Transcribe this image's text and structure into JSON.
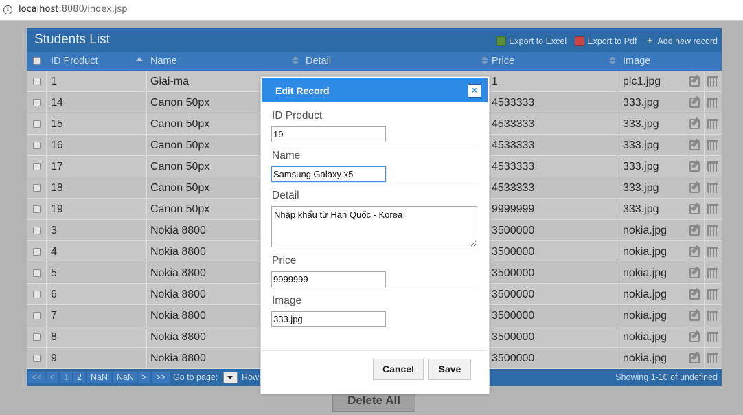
{
  "browser": {
    "url_host": "localhost",
    "url_rest": ":8080/index.jsp"
  },
  "grid": {
    "title": "Students List",
    "toolbar": {
      "excel": "Export to Excel",
      "pdf": "Export to Pdf",
      "add": "Add new record"
    },
    "columns": {
      "id": "ID Product",
      "name": "Name",
      "detail": "Detail",
      "price": "Price",
      "image": "Image"
    },
    "rows": [
      {
        "id": "1",
        "name": "Giai-ma",
        "price": "1",
        "image": "pic1.jpg"
      },
      {
        "id": "14",
        "name": "Canon 50px",
        "price": "4533333",
        "image": "333.jpg"
      },
      {
        "id": "15",
        "name": "Canon 50px",
        "price": "4533333",
        "image": "333.jpg"
      },
      {
        "id": "16",
        "name": "Canon 50px",
        "price": "4533333",
        "image": "333.jpg"
      },
      {
        "id": "17",
        "name": "Canon 50px",
        "price": "4533333",
        "image": "333.jpg"
      },
      {
        "id": "18",
        "name": "Canon 50px",
        "price": "4533333",
        "image": "333.jpg"
      },
      {
        "id": "19",
        "name": "Canon 50px",
        "price": "9999999",
        "image": "333.jpg"
      },
      {
        "id": "3",
        "name": "Nokia 8800",
        "price": "3500000",
        "image": "nokia.jpg"
      },
      {
        "id": "4",
        "name": "Nokia 8800",
        "price": "3500000",
        "image": "nokia.jpg"
      },
      {
        "id": "5",
        "name": "Nokia 8800",
        "price": "3500000",
        "image": "nokia.jpg"
      },
      {
        "id": "6",
        "name": "Nokia 8800",
        "price": "3500000",
        "image": "nokia.jpg"
      },
      {
        "id": "7",
        "name": "Nokia 8800",
        "price": "3500000",
        "image": "nokia.jpg"
      },
      {
        "id": "8",
        "name": "Nokia 8800",
        "price": "3500000",
        "image": "nokia.jpg"
      },
      {
        "id": "9",
        "name": "Nokia 8800",
        "price": "3500000",
        "image": "nokia.jpg"
      }
    ],
    "pager": {
      "first": "<<",
      "prev": "<",
      "page1": "1",
      "page2": "2",
      "nan1": "NaN",
      "nan2": "NaN",
      "next": ">",
      "last": ">>",
      "goto": "Go to page:",
      "rows": "Row",
      "status": "Showing 1-10 of undefined"
    },
    "delete_all": "Delete All"
  },
  "modal": {
    "title": "Edit Record",
    "close": "×",
    "fields": {
      "id": {
        "label": "ID Product",
        "value": "19"
      },
      "name": {
        "label": "Name",
        "value": "Samsung Galaxy x5"
      },
      "detail": {
        "label": "Detail",
        "value": "Nhập khẩu từ Hàn Quốc - Korea"
      },
      "price": {
        "label": "Price",
        "value": "9999999"
      },
      "image": {
        "label": "Image",
        "value": "333.jpg"
      }
    },
    "cancel": "Cancel",
    "save": "Save"
  },
  "colors": {
    "header_blue": "#2d6aa8",
    "modal_blue": "#2f8ae6",
    "overlay_gray": "#b5b5b5"
  }
}
